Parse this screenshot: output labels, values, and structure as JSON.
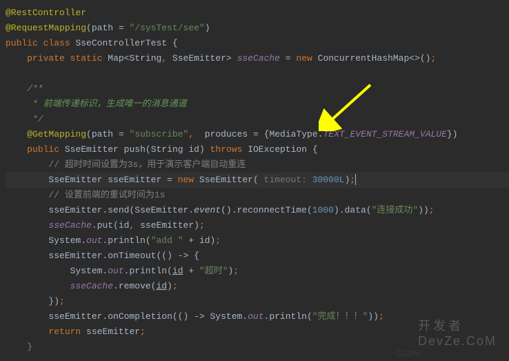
{
  "code": {
    "l1_annotation": "@RestController",
    "l2_annotation": "@RequestMapping",
    "l2_path_attr": "path",
    "l2_path_val": "\"/sysTest/see\"",
    "l3_public": "public",
    "l3_class": "class",
    "l3_classname": "SseControllerTest",
    "l4_private": "private",
    "l4_static": "static",
    "l4_map": "Map",
    "l4_string": "String",
    "l4_sseemitter": "SseEmitter",
    "l4_field": "sseCache",
    "l4_new": "new",
    "l4_chm": "ConcurrentHashMap",
    "l6_doc1": "/**",
    "l7_doc2": " * 前端传递标识，生成唯一的消息通道",
    "l8_doc3": " */",
    "l9_annotation": "@GetMapping",
    "l9_path_attr": "path",
    "l9_path_val": "\"subscribe\"",
    "l9_produces": "produces",
    "l9_mediatype": "MediaType",
    "l9_constant": "TEXT_EVENT_STREAM_VALUE",
    "l10_public": "public",
    "l10_type": "SseEmitter",
    "l10_method": "push",
    "l10_ptype": "String",
    "l10_pname": "id",
    "l10_throws": "throws",
    "l10_exc": "IOException",
    "l11_comment": "// 超时时间设置为3s，用于演示客户端自动重连",
    "l12_type": "SseEmitter",
    "l12_var": "sseEmitter",
    "l12_new": "new",
    "l12_ctor": "SseEmitter",
    "l12_hint": " timeout: ",
    "l12_val": "30000L",
    "l13_comment": "// 设置前端的重试时间为1s",
    "l14_var": "sseEmitter",
    "l14_send": "send",
    "l14_class": "SseEmitter",
    "l14_event": "event",
    "l14_reconnect": "reconnectTime",
    "l14_time": "1000",
    "l14_data": "data",
    "l14_str": "\"连接成功\"",
    "l15_field": "sseCache",
    "l15_put": "put",
    "l15_id": "id",
    "l15_var": "sseEmitter",
    "l16_sys": "System",
    "l16_out": "out",
    "l16_println": "println",
    "l16_str": "\"add \"",
    "l16_id": "id",
    "l17_var": "sseEmitter",
    "l17_ontimeout": "onTimeout",
    "l18_sys": "System",
    "l18_out": "out",
    "l18_println": "println",
    "l18_id": "id",
    "l18_str": "\"超时\"",
    "l19_field": "sseCache",
    "l19_remove": "remove",
    "l19_id": "id",
    "l21_var": "sseEmitter",
    "l21_oncompletion": "onCompletion",
    "l21_sys": "System",
    "l21_out": "out",
    "l21_println": "println",
    "l21_str": "\"完成！！！\"",
    "l22_return": "return",
    "l22_var": "sseEmitter"
  },
  "watermark": {
    "logo_text": "开发者",
    "logo_sub": "DevZe.CoM",
    "csdn": "CSDN"
  }
}
